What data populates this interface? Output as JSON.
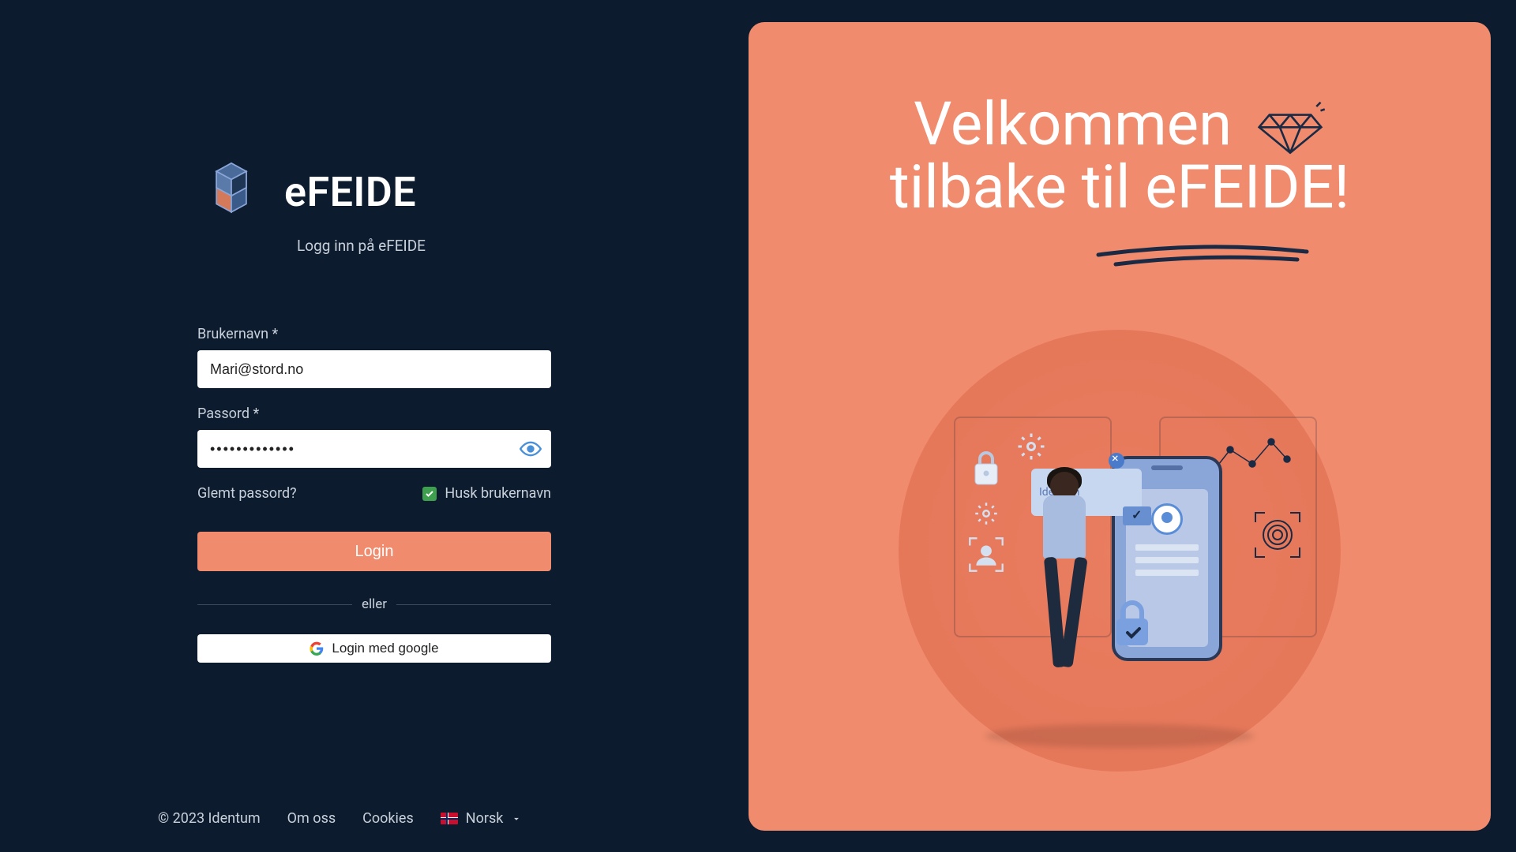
{
  "brand": {
    "name": "eFEIDE",
    "subtitle": "Logg inn på eFEIDE"
  },
  "form": {
    "username_label": "Brukernavn *",
    "username_value": "Mari@stord.no",
    "password_label": "Passord *",
    "password_value": "•••••••••••••",
    "forgot": "Glemt passord?",
    "remember": "Husk brukernavn",
    "login_button": "Login",
    "divider": "eller",
    "google_button": "Login med google"
  },
  "footer": {
    "copyright": "© 2023 Identum",
    "about": "Om  oss",
    "cookies": "Cookies",
    "language": "Norsk"
  },
  "welcome": {
    "line1": "Velkommen",
    "line2": "tilbake til eFEIDE!",
    "notif": "Identum"
  },
  "colors": {
    "accent": "#f08b6d",
    "bg": "#0d1b2e"
  }
}
